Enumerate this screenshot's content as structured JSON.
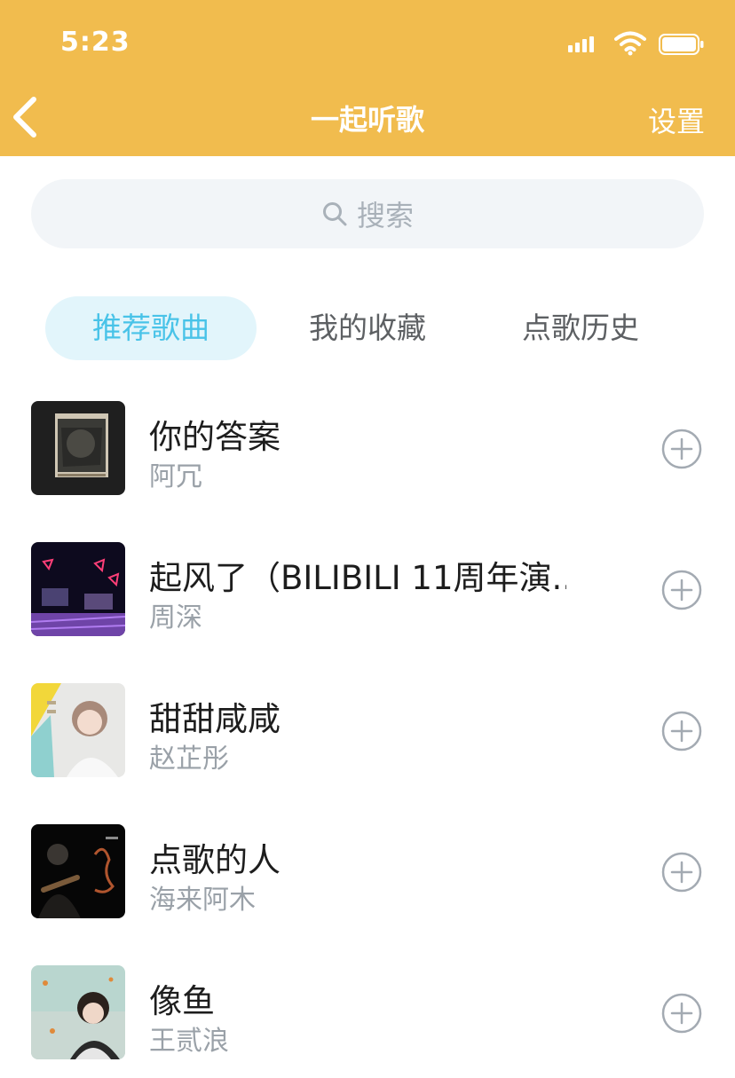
{
  "status_bar": {
    "time": "5:23",
    "icons": [
      "signal-icon",
      "wifi-icon",
      "battery-icon"
    ]
  },
  "nav": {
    "back_icon": "chevron-left-icon",
    "title": "一起听歌",
    "settings_label": "设置"
  },
  "search": {
    "icon": "search-icon",
    "placeholder": "搜索"
  },
  "tabs": [
    {
      "label": "推荐歌曲",
      "active": true
    },
    {
      "label": "我的收藏",
      "active": false
    },
    {
      "label": "点歌历史",
      "active": false
    }
  ],
  "songs": [
    {
      "title": "你的答案",
      "artist": "阿冗",
      "add_icon": "plus-circle-icon"
    },
    {
      "title": "起风了（BILIBILI 11周年演...",
      "artist": "周深",
      "add_icon": "plus-circle-icon"
    },
    {
      "title": "甜甜咸咸",
      "artist": "赵芷彤",
      "add_icon": "plus-circle-icon"
    },
    {
      "title": "点歌的人",
      "artist": "海来阿木",
      "add_icon": "plus-circle-icon"
    },
    {
      "title": "像鱼",
      "artist": "王贰浪",
      "add_icon": "plus-circle-icon"
    }
  ],
  "colors": {
    "header": "#F1BC4E",
    "active_tab_bg": "#E2F5FB",
    "active_tab_text": "#49C3E8",
    "search_bg": "#F2F5F8"
  }
}
